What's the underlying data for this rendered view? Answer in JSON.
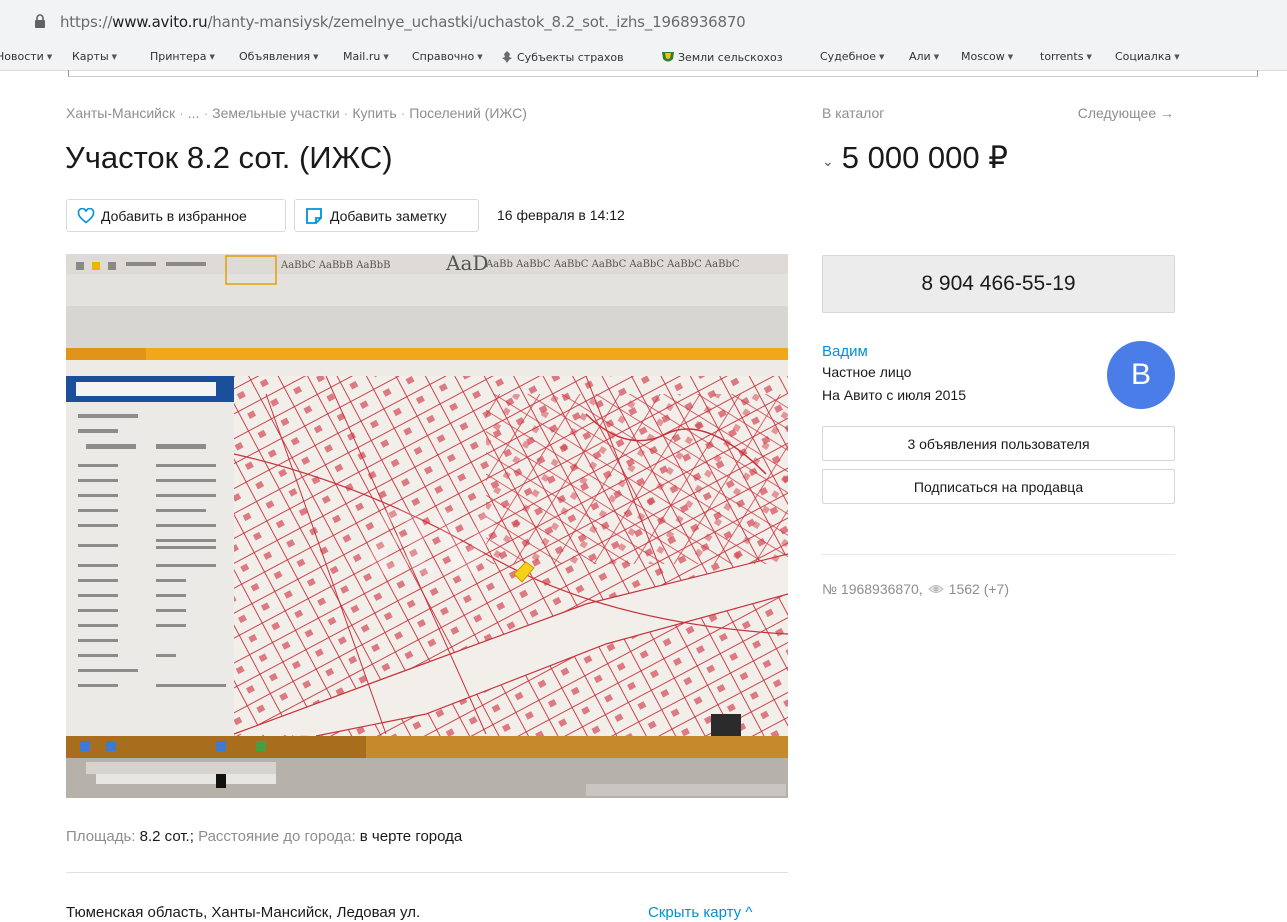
{
  "browser": {
    "url_prefix": "https://",
    "url_domain": "www.avito.ru",
    "url_path": "/hanty-mansiysk/zemelnye_uchastki/uchastok_8.2_sot._izhs_1968936870",
    "bookmarks": [
      {
        "label": "Новости",
        "icon": "dropdown-arrow",
        "arrow": "▼"
      },
      {
        "label": "Карты",
        "arrow": "▼"
      },
      {
        "label": "Принтера",
        "arrow": "▼"
      },
      {
        "label": "Объявления",
        "arrow": "▼"
      },
      {
        "label": "Mail.ru",
        "arrow": "▼"
      },
      {
        "label": "Справочно",
        "arrow": "▼"
      },
      {
        "label": "Субъекты страхов",
        "icon": "emblem-icon"
      },
      {
        "label": "Земли сельскохоз",
        "icon": "shield-icon"
      },
      {
        "label": "Судебное",
        "arrow": "▼"
      },
      {
        "label": "Али",
        "arrow": "▼"
      },
      {
        "label": "Moscow",
        "arrow": "▼"
      },
      {
        "label": "torrents",
        "arrow": "▼"
      },
      {
        "label": "Социалка",
        "arrow": "▼"
      }
    ]
  },
  "listing": {
    "breadcrumb": [
      "Ханты-Мансийск",
      "...",
      "Земельные участки",
      "Купить",
      "Поселений (ИЖС)"
    ],
    "title": "Участок 8.2 сот. (ИЖС)",
    "favorite_label": "Добавить в избранное",
    "note_label": "Добавить заметку",
    "date": "16 февраля в 14:12",
    "params_area_label": "Площадь:",
    "params_area_value": "8.2 сот.;",
    "params_distance_label": "Расстояние до города:",
    "params_distance_value": "в черте города",
    "address": "Тюменская область, Ханты-Мансийск, Ледовая ул.",
    "hide_map": "Скрыть карту ^"
  },
  "sidebar": {
    "catalog": "В каталог",
    "next": "Следующее →",
    "price": "5 000 000 ₽",
    "phone": "8 904 466-55-19",
    "seller_name": "Вадим",
    "seller_type": "Частное лицо",
    "seller_since": "На Авито с июля 2015",
    "avatar_letter": "B",
    "user_ads": "3 объявления пользователя",
    "subscribe": "Подписаться на продавца",
    "ad_number": "№ 1968936870,",
    "views": "1562 (+7)"
  },
  "colors": {
    "link": "#0091d9",
    "avatar": "#4a7de8",
    "map_lines": "#c8323c"
  }
}
